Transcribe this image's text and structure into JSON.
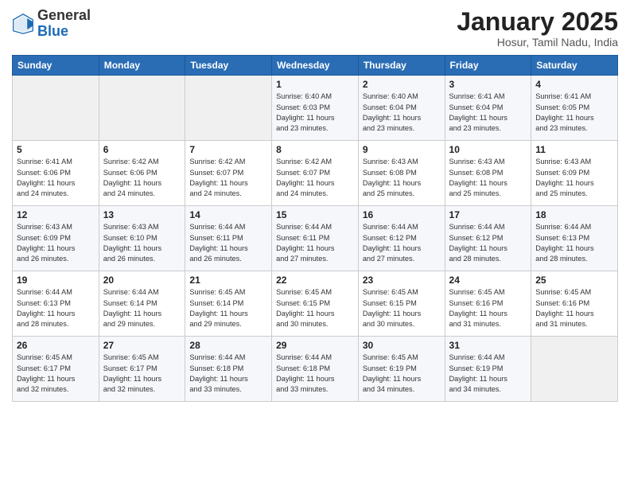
{
  "logo": {
    "general": "General",
    "blue": "Blue"
  },
  "header": {
    "month": "January 2025",
    "location": "Hosur, Tamil Nadu, India"
  },
  "days_of_week": [
    "Sunday",
    "Monday",
    "Tuesday",
    "Wednesday",
    "Thursday",
    "Friday",
    "Saturday"
  ],
  "weeks": [
    [
      {
        "day": "",
        "info": ""
      },
      {
        "day": "",
        "info": ""
      },
      {
        "day": "",
        "info": ""
      },
      {
        "day": "1",
        "info": "Sunrise: 6:40 AM\nSunset: 6:03 PM\nDaylight: 11 hours\nand 23 minutes."
      },
      {
        "day": "2",
        "info": "Sunrise: 6:40 AM\nSunset: 6:04 PM\nDaylight: 11 hours\nand 23 minutes."
      },
      {
        "day": "3",
        "info": "Sunrise: 6:41 AM\nSunset: 6:04 PM\nDaylight: 11 hours\nand 23 minutes."
      },
      {
        "day": "4",
        "info": "Sunrise: 6:41 AM\nSunset: 6:05 PM\nDaylight: 11 hours\nand 23 minutes."
      }
    ],
    [
      {
        "day": "5",
        "info": "Sunrise: 6:41 AM\nSunset: 6:06 PM\nDaylight: 11 hours\nand 24 minutes."
      },
      {
        "day": "6",
        "info": "Sunrise: 6:42 AM\nSunset: 6:06 PM\nDaylight: 11 hours\nand 24 minutes."
      },
      {
        "day": "7",
        "info": "Sunrise: 6:42 AM\nSunset: 6:07 PM\nDaylight: 11 hours\nand 24 minutes."
      },
      {
        "day": "8",
        "info": "Sunrise: 6:42 AM\nSunset: 6:07 PM\nDaylight: 11 hours\nand 24 minutes."
      },
      {
        "day": "9",
        "info": "Sunrise: 6:43 AM\nSunset: 6:08 PM\nDaylight: 11 hours\nand 25 minutes."
      },
      {
        "day": "10",
        "info": "Sunrise: 6:43 AM\nSunset: 6:08 PM\nDaylight: 11 hours\nand 25 minutes."
      },
      {
        "day": "11",
        "info": "Sunrise: 6:43 AM\nSunset: 6:09 PM\nDaylight: 11 hours\nand 25 minutes."
      }
    ],
    [
      {
        "day": "12",
        "info": "Sunrise: 6:43 AM\nSunset: 6:09 PM\nDaylight: 11 hours\nand 26 minutes."
      },
      {
        "day": "13",
        "info": "Sunrise: 6:43 AM\nSunset: 6:10 PM\nDaylight: 11 hours\nand 26 minutes."
      },
      {
        "day": "14",
        "info": "Sunrise: 6:44 AM\nSunset: 6:11 PM\nDaylight: 11 hours\nand 26 minutes."
      },
      {
        "day": "15",
        "info": "Sunrise: 6:44 AM\nSunset: 6:11 PM\nDaylight: 11 hours\nand 27 minutes."
      },
      {
        "day": "16",
        "info": "Sunrise: 6:44 AM\nSunset: 6:12 PM\nDaylight: 11 hours\nand 27 minutes."
      },
      {
        "day": "17",
        "info": "Sunrise: 6:44 AM\nSunset: 6:12 PM\nDaylight: 11 hours\nand 28 minutes."
      },
      {
        "day": "18",
        "info": "Sunrise: 6:44 AM\nSunset: 6:13 PM\nDaylight: 11 hours\nand 28 minutes."
      }
    ],
    [
      {
        "day": "19",
        "info": "Sunrise: 6:44 AM\nSunset: 6:13 PM\nDaylight: 11 hours\nand 28 minutes."
      },
      {
        "day": "20",
        "info": "Sunrise: 6:44 AM\nSunset: 6:14 PM\nDaylight: 11 hours\nand 29 minutes."
      },
      {
        "day": "21",
        "info": "Sunrise: 6:45 AM\nSunset: 6:14 PM\nDaylight: 11 hours\nand 29 minutes."
      },
      {
        "day": "22",
        "info": "Sunrise: 6:45 AM\nSunset: 6:15 PM\nDaylight: 11 hours\nand 30 minutes."
      },
      {
        "day": "23",
        "info": "Sunrise: 6:45 AM\nSunset: 6:15 PM\nDaylight: 11 hours\nand 30 minutes."
      },
      {
        "day": "24",
        "info": "Sunrise: 6:45 AM\nSunset: 6:16 PM\nDaylight: 11 hours\nand 31 minutes."
      },
      {
        "day": "25",
        "info": "Sunrise: 6:45 AM\nSunset: 6:16 PM\nDaylight: 11 hours\nand 31 minutes."
      }
    ],
    [
      {
        "day": "26",
        "info": "Sunrise: 6:45 AM\nSunset: 6:17 PM\nDaylight: 11 hours\nand 32 minutes."
      },
      {
        "day": "27",
        "info": "Sunrise: 6:45 AM\nSunset: 6:17 PM\nDaylight: 11 hours\nand 32 minutes."
      },
      {
        "day": "28",
        "info": "Sunrise: 6:44 AM\nSunset: 6:18 PM\nDaylight: 11 hours\nand 33 minutes."
      },
      {
        "day": "29",
        "info": "Sunrise: 6:44 AM\nSunset: 6:18 PM\nDaylight: 11 hours\nand 33 minutes."
      },
      {
        "day": "30",
        "info": "Sunrise: 6:45 AM\nSunset: 6:19 PM\nDaylight: 11 hours\nand 34 minutes."
      },
      {
        "day": "31",
        "info": "Sunrise: 6:44 AM\nSunset: 6:19 PM\nDaylight: 11 hours\nand 34 minutes."
      },
      {
        "day": "",
        "info": ""
      }
    ]
  ]
}
